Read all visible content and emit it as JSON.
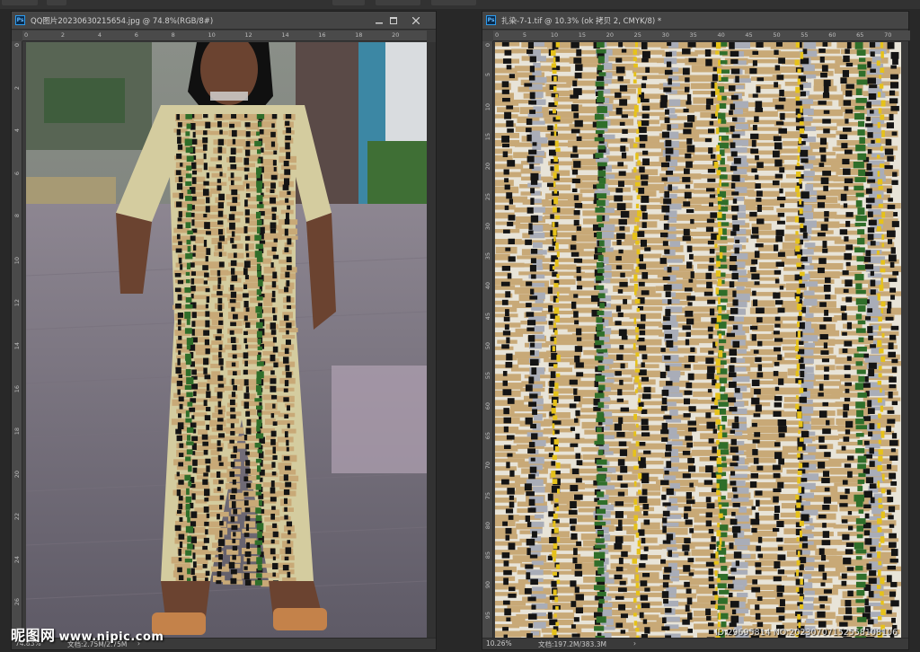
{
  "left_window": {
    "title": "QQ图片20230630215654.jpg @ 74.8%(RGB/8#)",
    "ruler_h": [
      "0",
      "2",
      "4",
      "6",
      "8",
      "10",
      "12",
      "14",
      "16",
      "18",
      "20"
    ],
    "ruler_v": [
      "0",
      "2",
      "4",
      "6",
      "8",
      "10",
      "12",
      "14",
      "16",
      "18",
      "20",
      "22",
      "24",
      "26"
    ],
    "zoom": "74.83%",
    "doc_info": "文档:2.75M/2.75M"
  },
  "right_window": {
    "title": "扎染-7-1.tif @ 10.3% (ok 拷贝 2, CMYK/8) *",
    "ruler_h": [
      "0",
      "5",
      "10",
      "15",
      "20",
      "25",
      "30",
      "35",
      "40",
      "45",
      "50",
      "55",
      "60",
      "65",
      "70"
    ],
    "ruler_v": [
      "0",
      "5",
      "10",
      "15",
      "20",
      "25",
      "30",
      "35",
      "40",
      "45",
      "50",
      "55",
      "60",
      "65",
      "70",
      "75",
      "80",
      "85",
      "90",
      "95"
    ],
    "zoom": "10.26%",
    "doc_info": "文档:197.2M/383.3M"
  },
  "watermark": {
    "brand": "昵图网",
    "url": "www.nipic.com"
  },
  "image_id": "ID:29695814 NO:20230707152558108106",
  "colors": {
    "panel_bg": "#282828",
    "window_bg": "#3a3a3a",
    "pattern_cream": "#e8e4d8",
    "pattern_tan": "#c8a977",
    "pattern_black": "#141414",
    "pattern_green": "#2f6e2a",
    "pattern_grey": "#a9adb8",
    "pattern_yellow": "#e6c21a"
  },
  "icons": [
    "ps-document-icon",
    "minimize-icon",
    "maximize-icon",
    "close-icon"
  ]
}
